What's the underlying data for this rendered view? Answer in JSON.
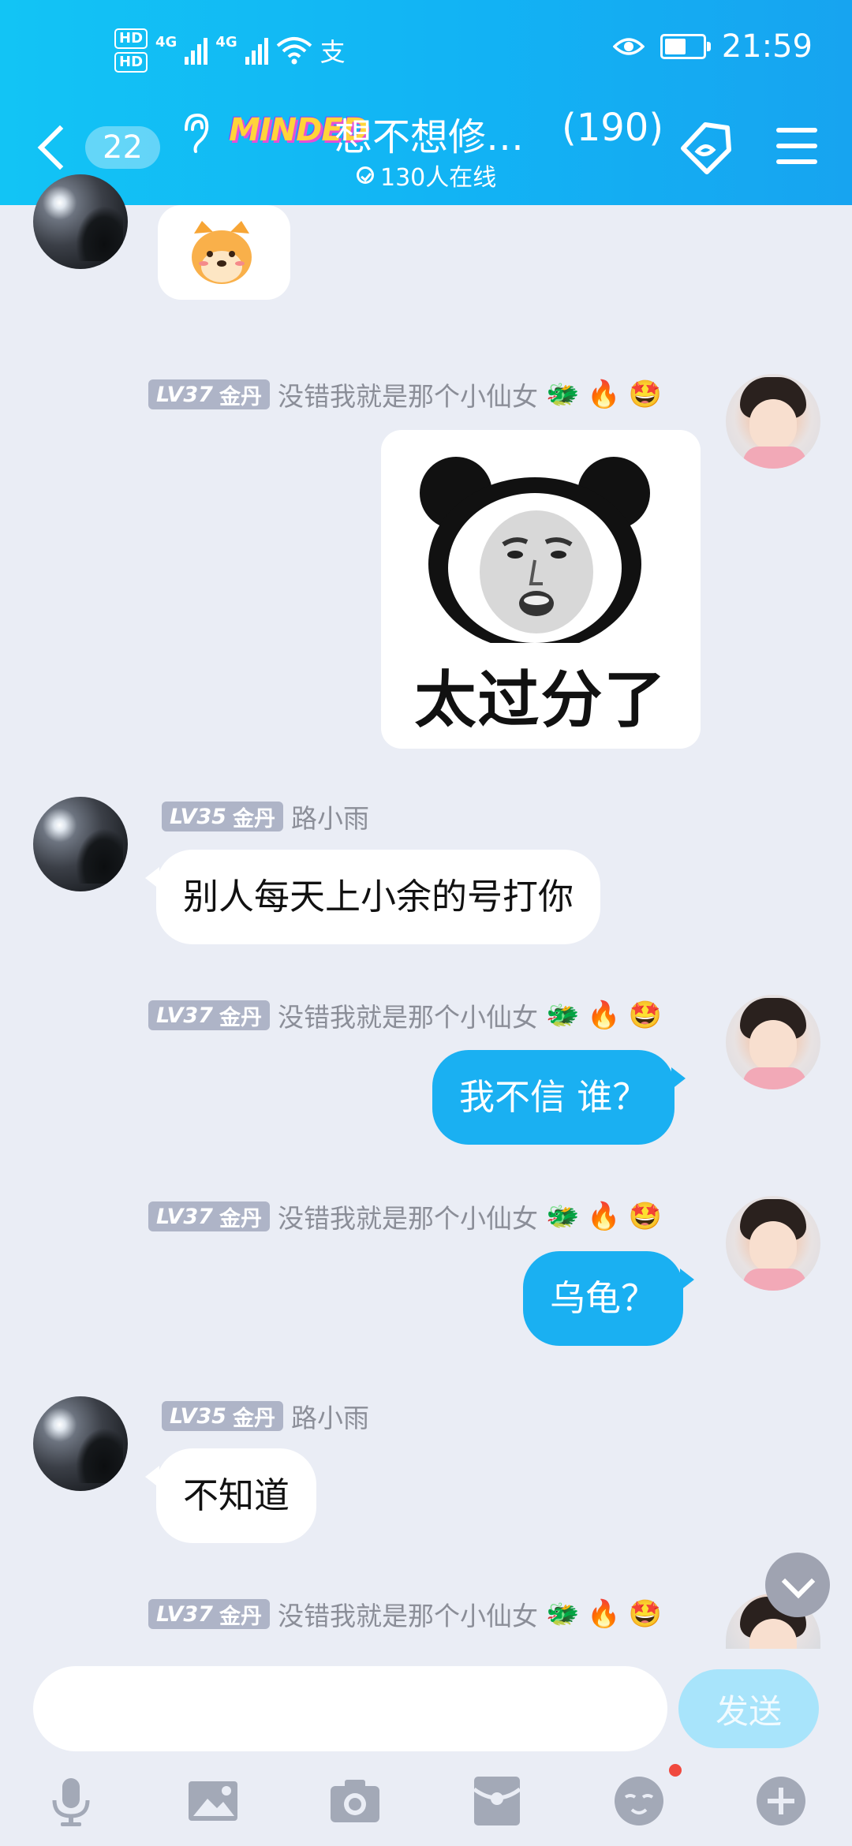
{
  "status_bar": {
    "hd1": "HD",
    "hd2": "HD",
    "net1": "4G",
    "net2": "4G",
    "pay_icon": "支",
    "time": "21:59"
  },
  "header": {
    "badge_count": "22",
    "group_logo": "MINDED",
    "group_name": "想不想修…",
    "member_count": "(190)",
    "online_text": "130人在线",
    "bg_color": "#14B8F5"
  },
  "messages": [
    {
      "side": "left",
      "type": "sticker",
      "sticker_name": "shiba-sticker"
    },
    {
      "side": "right",
      "level": "LV37",
      "title": "金丹",
      "nickname": "没错我就是那个小仙女",
      "type": "sticker",
      "sticker_text": "太过分了"
    },
    {
      "side": "left",
      "level": "LV35",
      "title": "金丹",
      "nickname": "路小雨",
      "text": "别人每天上小余的号打你"
    },
    {
      "side": "right",
      "level": "LV37",
      "title": "金丹",
      "nickname": "没错我就是那个小仙女",
      "text": "我不信 谁？"
    },
    {
      "side": "right",
      "level": "LV37",
      "title": "金丹",
      "nickname": "没错我就是那个小仙女",
      "text": "乌龟？"
    },
    {
      "side": "left",
      "level": "LV35",
      "title": "金丹",
      "nickname": "路小雨",
      "text": "不知道"
    },
    {
      "side": "right",
      "level": "LV37",
      "title": "金丹",
      "nickname": "没错我就是那个小仙女"
    }
  ],
  "input": {
    "placeholder": "",
    "send_label": "发送"
  },
  "toolbar": {
    "icons": [
      "microphone-icon",
      "image-icon",
      "camera-icon",
      "red-packet-icon",
      "emoji-icon",
      "plus-icon"
    ],
    "emoji_has_notification": true
  },
  "colors": {
    "accent": "#1AB0F2",
    "background": "#EAEDF5",
    "level_badge": "#AEB4C7",
    "send_disabled": "#A8E4FB"
  }
}
